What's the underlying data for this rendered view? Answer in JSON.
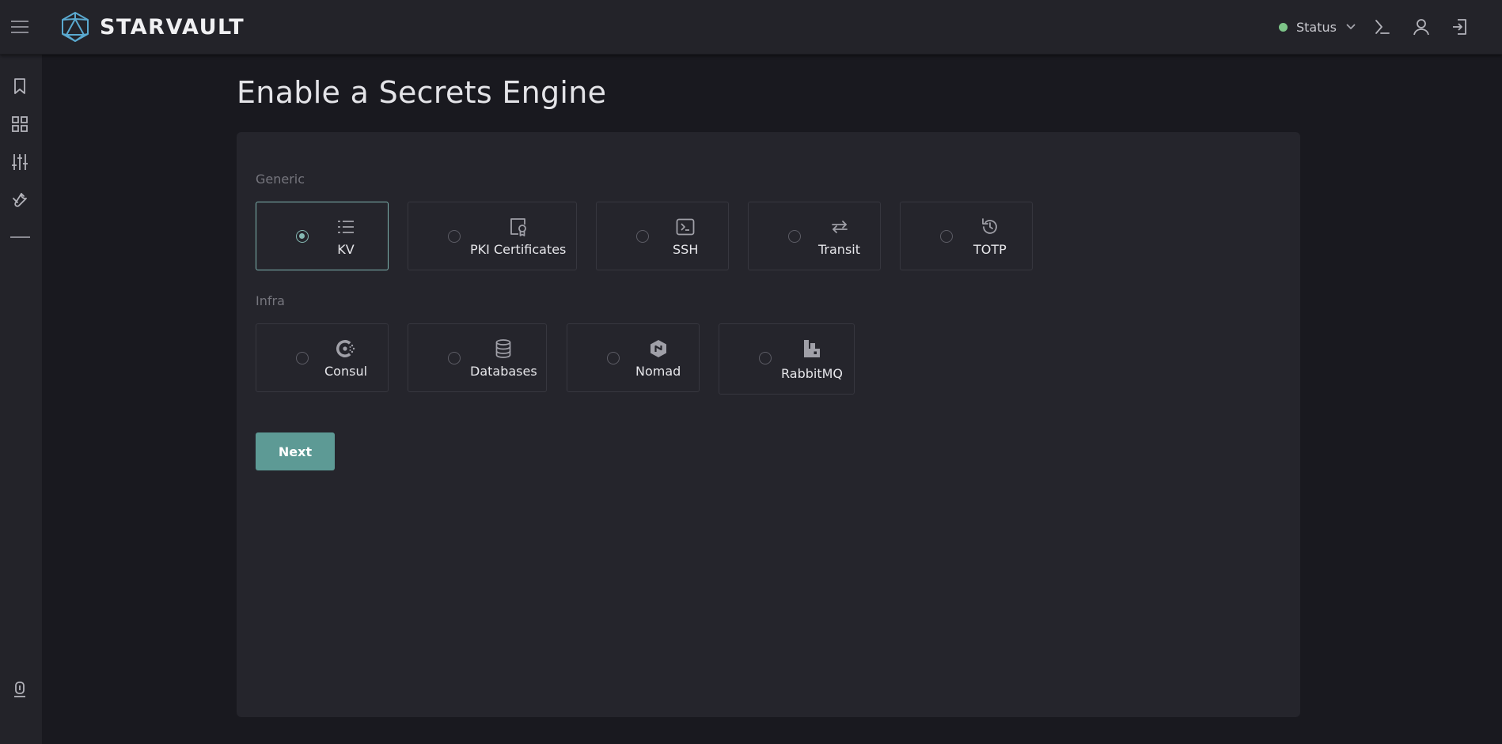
{
  "app": {
    "name": "STARVAULT"
  },
  "header": {
    "status_label": "Status"
  },
  "page": {
    "title": "Enable a Secrets Engine"
  },
  "sections": {
    "generic": {
      "label": "Generic",
      "engines": [
        {
          "label": "KV",
          "icon": "list-icon",
          "selected": true
        },
        {
          "label": "PKI Certificates",
          "icon": "certificate-icon",
          "selected": false
        },
        {
          "label": "SSH",
          "icon": "terminal-icon",
          "selected": false
        },
        {
          "label": "Transit",
          "icon": "arrows-exchange-icon",
          "selected": false
        },
        {
          "label": "TOTP",
          "icon": "history-icon",
          "selected": false
        }
      ]
    },
    "infra": {
      "label": "Infra",
      "engines": [
        {
          "label": "Consul",
          "icon": "consul-icon",
          "selected": false
        },
        {
          "label": "Databases",
          "icon": "database-icon",
          "selected": false
        },
        {
          "label": "Nomad",
          "icon": "nomad-icon",
          "selected": false
        },
        {
          "label": "RabbitMQ",
          "icon": "rabbitmq-icon",
          "selected": false
        }
      ]
    }
  },
  "actions": {
    "next_label": "Next"
  },
  "colors": {
    "accent": "#5d9a95",
    "selected_border": "#7fb5b0",
    "status_ok": "#7dc488",
    "background": "#19191f",
    "panel": "#25252c"
  }
}
